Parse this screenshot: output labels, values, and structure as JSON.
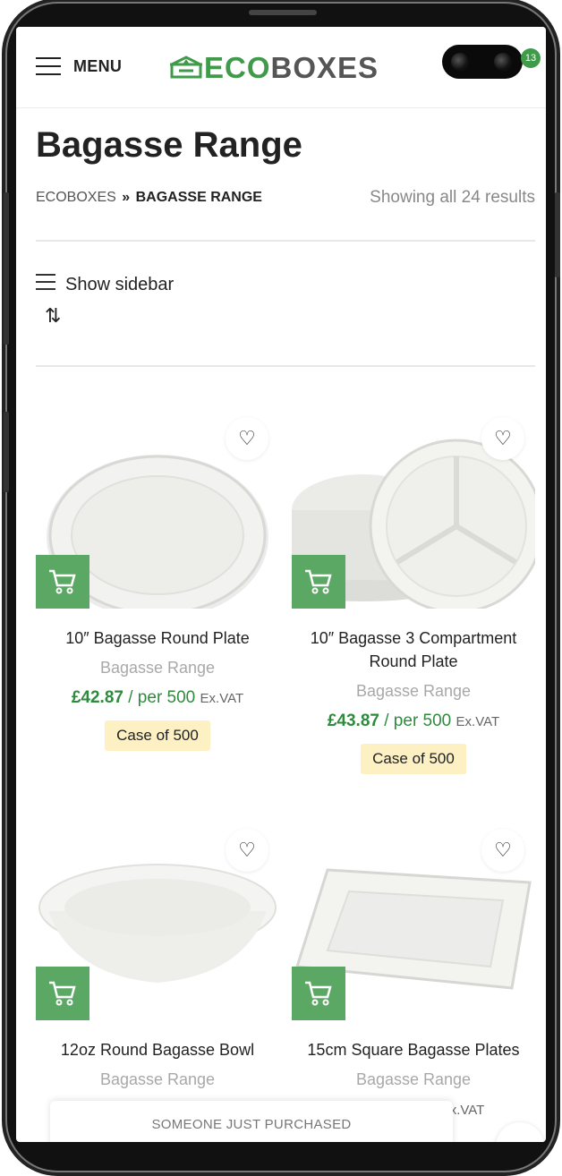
{
  "header": {
    "menu_label": "MENU",
    "logo_eco": "ECO",
    "logo_boxes": "BOXES",
    "cart_count": "13"
  },
  "page": {
    "title": "Bagasse Range",
    "breadcrumb_home": "ECOBOXES",
    "breadcrumb_sep": "»",
    "breadcrumb_current": "BAGASSE RANGE",
    "results": "Showing all 24 results",
    "show_sidebar": "Show sidebar"
  },
  "products": [
    {
      "name": "10″ Bagasse Round Plate",
      "category": "Bagasse Range",
      "price": "£42.87",
      "per": "/ per 500",
      "exvat": "Ex.VAT",
      "case": "Case of 500"
    },
    {
      "name": "10″ Bagasse 3 Compartment Round Plate",
      "category": "Bagasse Range",
      "price": "£43.87",
      "per": "/ per 500",
      "exvat": "Ex.VAT",
      "case": "Case of 500"
    },
    {
      "name": "12oz Round Bagasse Bowl",
      "category": "Bagasse Range",
      "price": "",
      "per": "",
      "exvat": "",
      "case": ""
    },
    {
      "name": "15cm Square Bagasse Plates",
      "category": "Bagasse Range",
      "price": "",
      "per": "",
      "exvat": "Ex.VAT",
      "case": ""
    }
  ],
  "popup": {
    "text": "SOMEONE JUST PURCHASED"
  },
  "colors": {
    "brand_green": "#3f9a4a",
    "cart_button": "#5aa863",
    "price": "#2f8a3e",
    "badge_bg": "#fdf0c2"
  }
}
